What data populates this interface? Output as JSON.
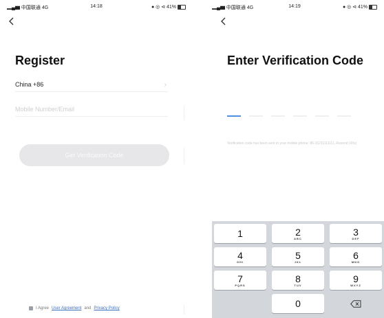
{
  "register_screen": {
    "status_bar": {
      "carrier": "▂▄▆ 中国联通 4G",
      "time": "14:18",
      "right_icons": "● ◎ ⊲ 41%",
      "battery_level": 0.41
    },
    "title": "Register",
    "country_value": "China +86",
    "account_placeholder": "Mobile Number/Email",
    "get_code_label": "Get Verification Code",
    "agreement": {
      "prefix": "I Agree",
      "user_agreement": "User Agreement",
      "and": "and",
      "privacy_policy": "Privacy Policy"
    }
  },
  "verify_screen": {
    "status_bar": {
      "carrier": "▂▄▆ 中国联通 4G",
      "time": "14:19",
      "right_icons": "● ◎ ⊲ 41%",
      "battery_level": 0.41
    },
    "title": "Enter Verification Code",
    "code_segments": 6,
    "hint": "Verification code has been sent to your mobile phone: 86-15211111111, Resend (43s)"
  },
  "keypad": {
    "keys": [
      {
        "num": "1",
        "sub": ""
      },
      {
        "num": "2",
        "sub": "ABC"
      },
      {
        "num": "3",
        "sub": "DEF"
      },
      {
        "num": "4",
        "sub": "GHI"
      },
      {
        "num": "5",
        "sub": "JKL"
      },
      {
        "num": "6",
        "sub": "MNO"
      },
      {
        "num": "7",
        "sub": "PQRS"
      },
      {
        "num": "8",
        "sub": "TUV"
      },
      {
        "num": "9",
        "sub": "WXYZ"
      },
      {
        "num": "0",
        "sub": ""
      }
    ]
  }
}
